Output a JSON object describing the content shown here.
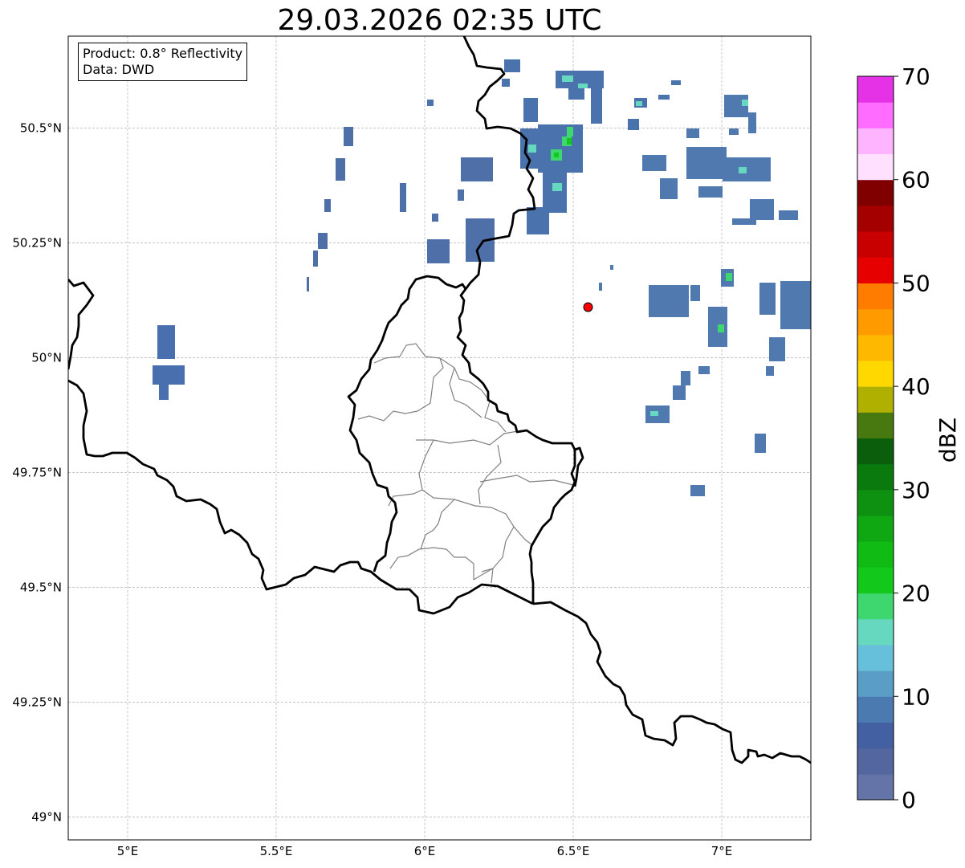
{
  "title": "29.03.2026 02:35 UTC",
  "info": {
    "product": "Product: 0.8° Reflectivity",
    "data": "Data: DWD"
  },
  "map": {
    "extent": {
      "lon_min": 4.8,
      "lon_max": 7.3,
      "lat_min": 48.95,
      "lat_max": 50.7
    },
    "x_ticks": [
      {
        "lon": 5.0,
        "label": "5°E"
      },
      {
        "lon": 5.5,
        "label": "5.5°E"
      },
      {
        "lon": 6.0,
        "label": "6°E"
      },
      {
        "lon": 6.5,
        "label": "6.5°E"
      },
      {
        "lon": 7.0,
        "label": "7°E"
      }
    ],
    "y_ticks": [
      {
        "lat": 50.5,
        "label": "50.5°N"
      },
      {
        "lat": 50.25,
        "label": "50.25°N"
      },
      {
        "lat": 50.0,
        "label": "50°N"
      },
      {
        "lat": 49.75,
        "label": "49.75°N"
      },
      {
        "lat": 49.5,
        "label": "49.5°N"
      },
      {
        "lat": 49.25,
        "label": "49.25°N"
      },
      {
        "lat": 49.0,
        "label": "49°N"
      }
    ],
    "radar_site": {
      "lon": 6.55,
      "lat": 50.11,
      "color": "#ff0000"
    },
    "country_border_color": "#000000",
    "canton_border_color": "#808080"
  },
  "colorbar": {
    "label": "dBZ",
    "min": 0,
    "max": 70,
    "step": 2.5,
    "ticks": [
      {
        "value": 0,
        "label": "0"
      },
      {
        "value": 10,
        "label": "10"
      },
      {
        "value": 20,
        "label": "20"
      },
      {
        "value": 30,
        "label": "30"
      },
      {
        "value": 40,
        "label": "40"
      },
      {
        "value": 50,
        "label": "50"
      },
      {
        "value": 60,
        "label": "60"
      },
      {
        "value": 70,
        "label": "70"
      }
    ],
    "colors": [
      "#6473a8",
      "#5366a0",
      "#4360a3",
      "#4a7ab0",
      "#5a9ec8",
      "#66c0dc",
      "#66d8c0",
      "#3ed66e",
      "#12c81a",
      "#10bc14",
      "#10a812",
      "#0e9010",
      "#0a7a0e",
      "#0a5e0c",
      "#487810",
      "#b0b000",
      "#ffd800",
      "#ffb800",
      "#ff9a00",
      "#ff7c00",
      "#e60000",
      "#c80000",
      "#a40000",
      "#800000",
      "#ffe0ff",
      "#ffb4ff",
      "#ff6cff",
      "#e632e6"
    ]
  }
}
